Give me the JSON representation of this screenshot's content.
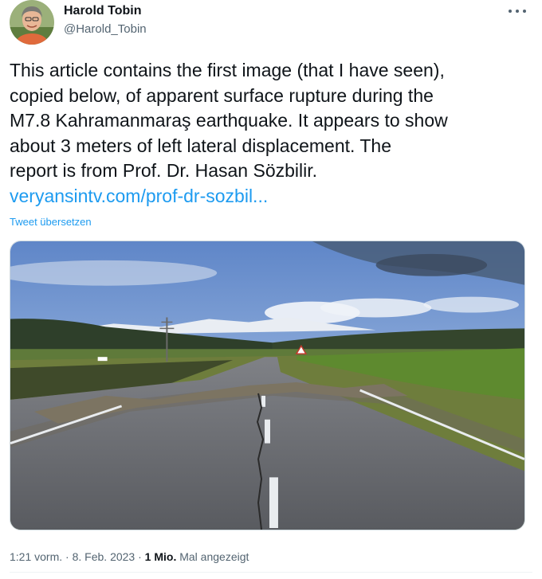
{
  "author": {
    "display_name": "Harold Tobin",
    "handle": "@Harold_Tobin",
    "avatar_icon": "profile-photo"
  },
  "more_icon": "more-horizontal-icon",
  "tweet": {
    "text": "This article contains the first image (that I have seen),\ncopied below,  of apparent surface rupture during the\nM7.8 Kahramanmaraş earthquake. It appears to show\nabout 3 meters of left lateral displacement. The\nreport is from Prof. Dr. Hasan Sözbilir.",
    "link": "veryansintv.com/prof-dr-sozbil...",
    "translate_label": "Tweet übersetzen"
  },
  "media": {
    "alt": "Road with surface rupture crack and offset after earthquake, snowy mountains in background"
  },
  "meta": {
    "time": "1:21 vorm.",
    "sep1": "·",
    "date": "8. Feb. 2023",
    "sep2": "·",
    "views_count": "1 Mio.",
    "views_label": "Mal angezeigt"
  },
  "colors": {
    "link": "#1d9bf0",
    "secondary_text": "#536471",
    "primary_text": "#0f1419"
  }
}
